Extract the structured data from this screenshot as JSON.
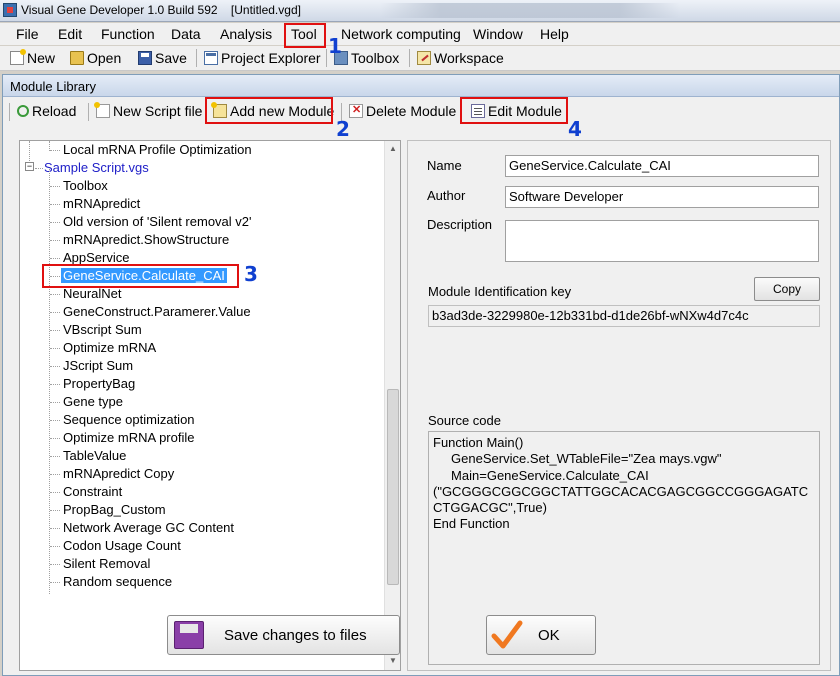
{
  "window": {
    "title": "Visual Gene Developer 1.0 Build 592    [Untitled.vgd]"
  },
  "menu": {
    "items": [
      "File",
      "Edit",
      "Function",
      "Data",
      "Analysis",
      "Tool",
      "Network computing",
      "Window",
      "Help"
    ]
  },
  "app_toolbar": {
    "new": "New",
    "open": "Open",
    "save": "Save",
    "project_explorer": "Project Explorer",
    "toolbox": "Toolbox",
    "workspace": "Workspace"
  },
  "dialog": {
    "title": "Module Library",
    "toolbar": {
      "reload": "Reload",
      "new_script_file": "New Script file",
      "add_new_module": "Add new Module",
      "delete_module": "Delete Module",
      "edit_module": "Edit Module"
    },
    "tree": {
      "top_item": "Local mRNA Profile Optimization",
      "root": "Sample Script.vgs",
      "children": [
        "Toolbox",
        "mRNApredict",
        "Old version of 'Silent removal v2'",
        "mRNApredict.ShowStructure",
        "AppService",
        "GeneService.Calculate_CAI",
        "NeuralNet",
        "GeneConstruct.Paramerer.Value",
        "VBscript Sum",
        "Optimize mRNA",
        "JScript Sum",
        "PropertyBag",
        "Gene type",
        "Sequence optimization",
        "Optimize mRNA profile",
        "TableValue",
        "mRNApredict Copy",
        "Constraint",
        "PropBag_Custom",
        "Network Average GC Content",
        "Codon Usage Count",
        "Silent Removal",
        "Random sequence"
      ],
      "selected": "GeneService.Calculate_CAI"
    },
    "details": {
      "name_label": "Name",
      "name_value": "GeneService.Calculate_CAI",
      "author_label": "Author",
      "author_value": "Software Developer",
      "description_label": "Description",
      "description_value": "",
      "key_label": "Module Identification key",
      "copy_button": "Copy",
      "key_value": "b3ad3de-3229980e-12b331bd-d1de26bf-wNXw4d7c4c",
      "source_label": "Source code",
      "source_lines": [
        "Function Main()",
        "     GeneService.Set_WTableFile=\"Zea mays.vgw\"",
        "     Main=GeneService.Calculate_CAI",
        "(\"GCGGGCGGCGGCTATTGGCACACGAGCGGCCGGGAGATC",
        "CTGGACGC\",True)",
        "End Function"
      ]
    },
    "buttons": {
      "save_changes": "Save changes to files",
      "ok": "OK"
    }
  },
  "annotations": {
    "step1": "1",
    "step2": "2",
    "step3": "3",
    "step4": "4"
  },
  "icons": {
    "app": "app-icon",
    "new": "new-file-icon",
    "open": "open-folder-icon",
    "save": "save-disk-icon",
    "project_explorer": "project-explorer-icon",
    "toolbox": "toolbox-icon",
    "workspace": "workspace-icon",
    "reload": "reload-icon",
    "new_script": "new-script-icon",
    "add_module": "add-module-icon",
    "delete_module": "delete-module-icon",
    "edit_module": "edit-module-icon",
    "save_changes": "floppy-disk-icon",
    "ok": "checkmark-icon"
  },
  "colors": {
    "annotation_box": "#e01010",
    "annotation_number": "#1040d0",
    "selection": "#3399ff",
    "tree_root": "#2020c8",
    "ok_check": "#f07820"
  }
}
